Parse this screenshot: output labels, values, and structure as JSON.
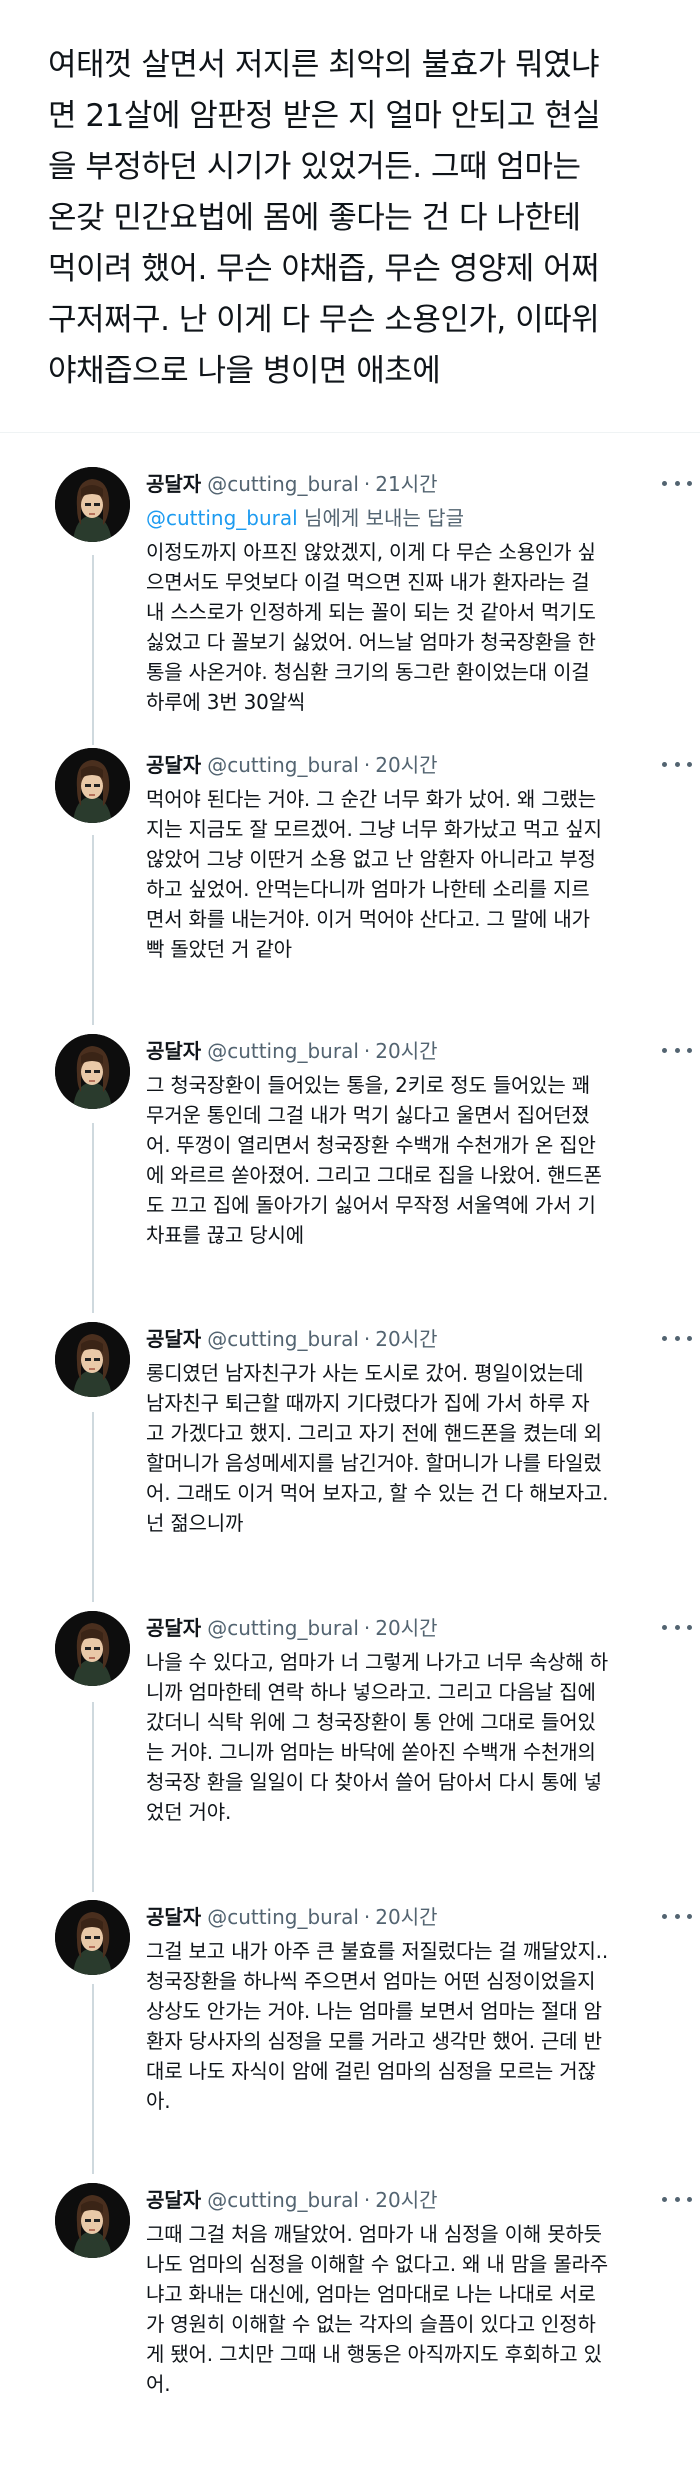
{
  "main_tweet": {
    "text": "여태껏 살면서 저지른 최악의 불효가 뭐였냐\n면 21살에 암판정 받은 지 얼마 안되고 현실\n을 부정하던 시기가 있었거든. 그때 엄마는\n온갖 민간요법에 몸에 좋다는 건 다 나한테\n먹이려 했어. 무슨 야채즙, 무슨 영양제 어쩌\n구저쩌구. 난 이게 다 무슨 소용인가, 이따위\n야채즙으로 나을 병이면 애초에"
  },
  "replies": [
    {
      "name": "공달자",
      "handle": "@cutting_bural",
      "time": "21시간",
      "reply_to_mention": "@cutting_bural",
      "reply_to_suffix": " 님에게 보내는 답글",
      "text": "이정도까지 아프진 않았겠지, 이게 다 무슨 소용인가 싶\n으면서도 무엇보다 이걸 먹으면 진짜 내가 환자라는 걸\n내 스스로가 인정하게 되는 꼴이 되는 것 같아서 먹기도\n싫었고 다 꼴보기 싫었어. 어느날 엄마가 청국장환을 한\n통을 사온거야. 청심환 크기의 동그란 환이었는대 이걸\n하루에 3번 30알씩"
    },
    {
      "name": "공달자",
      "handle": "@cutting_bural",
      "time": "20시간",
      "text": "먹어야 된다는 거야. 그 순간 너무 화가 났어. 왜 그랬는\n지는 지금도 잘 모르겠어. 그냥 너무 화가났고 먹고 싶지\n않았어 그냥 이딴거 소용 없고 난 암환자 아니라고 부정\n하고 싶었어. 안먹는다니까 엄마가 나한테 소리를 지르\n면서 화를 내는거야. 이거 먹어야 산다고. 그 말에 내가\n빡 돌았던 거 같아"
    },
    {
      "name": "공달자",
      "handle": "@cutting_bural",
      "time": "20시간",
      "text": "그 청국장환이 들어있는 통을, 2키로 정도 들어있는 꽤\n무거운 통인데 그걸 내가 먹기 싫다고 울면서 집어던졌\n어. 뚜껑이 열리면서 청국장환 수백개 수천개가 온 집안\n에 와르르 쏟아졌어. 그리고 그대로 집을 나왔어. 핸드폰\n도 끄고 집에 돌아가기 싫어서 무작정 서울역에 가서 기\n차표를 끊고 당시에"
    },
    {
      "name": "공달자",
      "handle": "@cutting_bural",
      "time": "20시간",
      "text": "롱디였던 남자친구가 사는 도시로 갔어. 평일이었는데\n남자친구 퇴근할 때까지 기다렸다가 집에 가서 하루 자\n고 가겠다고 했지. 그리고 자기 전에 핸드폰을 켰는데 외\n할머니가 음성메세지를 남긴거야. 할머니가 나를 타일렀\n어. 그래도 이거 먹어 보자고, 할 수 있는 건 다 해보자고.\n넌 젊으니까"
    },
    {
      "name": "공달자",
      "handle": "@cutting_bural",
      "time": "20시간",
      "text": "나을 수 있다고, 엄마가 너 그렇게 나가고 너무 속상해 하\n니까 엄마한테 연락 하나 넣으라고. 그리고 다음날 집에\n갔더니 식탁 위에 그 청국장환이 통 안에 그대로 들어있\n는 거야. 그니까 엄마는 바닥에 쏟아진 수백개 수천개의\n청국장 환을 일일이 다 찾아서 쓸어 담아서 다시 통에 넣\n었던 거야."
    },
    {
      "name": "공달자",
      "handle": "@cutting_bural",
      "time": "20시간",
      "text": "그걸 보고 내가 아주 큰 불효를 저질렀다는 걸 깨달았지..\n청국장환을 하나씩 주으면서 엄마는 어떤 심정이었을지\n상상도 안가는 거야. 나는 엄마를 보면서 엄마는 절대 암\n환자 당사자의 심정을 모를 거라고 생각만 했어. 근데 반\n대로 나도 자식이 암에 걸린 엄마의 심정을 모르는 거잖\n아."
    },
    {
      "name": "공달자",
      "handle": "@cutting_bural",
      "time": "20시간",
      "text": "그때 그걸 처음 깨달았어. 엄마가 내 심정을 이해 못하듯\n나도 엄마의 심정을 이해할 수 없다고. 왜 내 맘을 몰라주\n냐고 화내는 대신에, 엄마는 엄마대로 나는 나대로 서로\n가 영원히 이해할 수 없는 각자의 슬픔이 있다고 인정하\n게 됐어. 그치만 그때 내 행동은 아직까지도 후회하고 있\n어."
    }
  ],
  "colors": {
    "text": "#0f1419",
    "secondary": "#536471",
    "link": "#1d9bf0",
    "thread_line": "#cfd9de",
    "avatar_bg": "#0d0d0d"
  },
  "icons": {
    "avatar": "avatar-illustration-icon",
    "more": "more-options-icon"
  }
}
